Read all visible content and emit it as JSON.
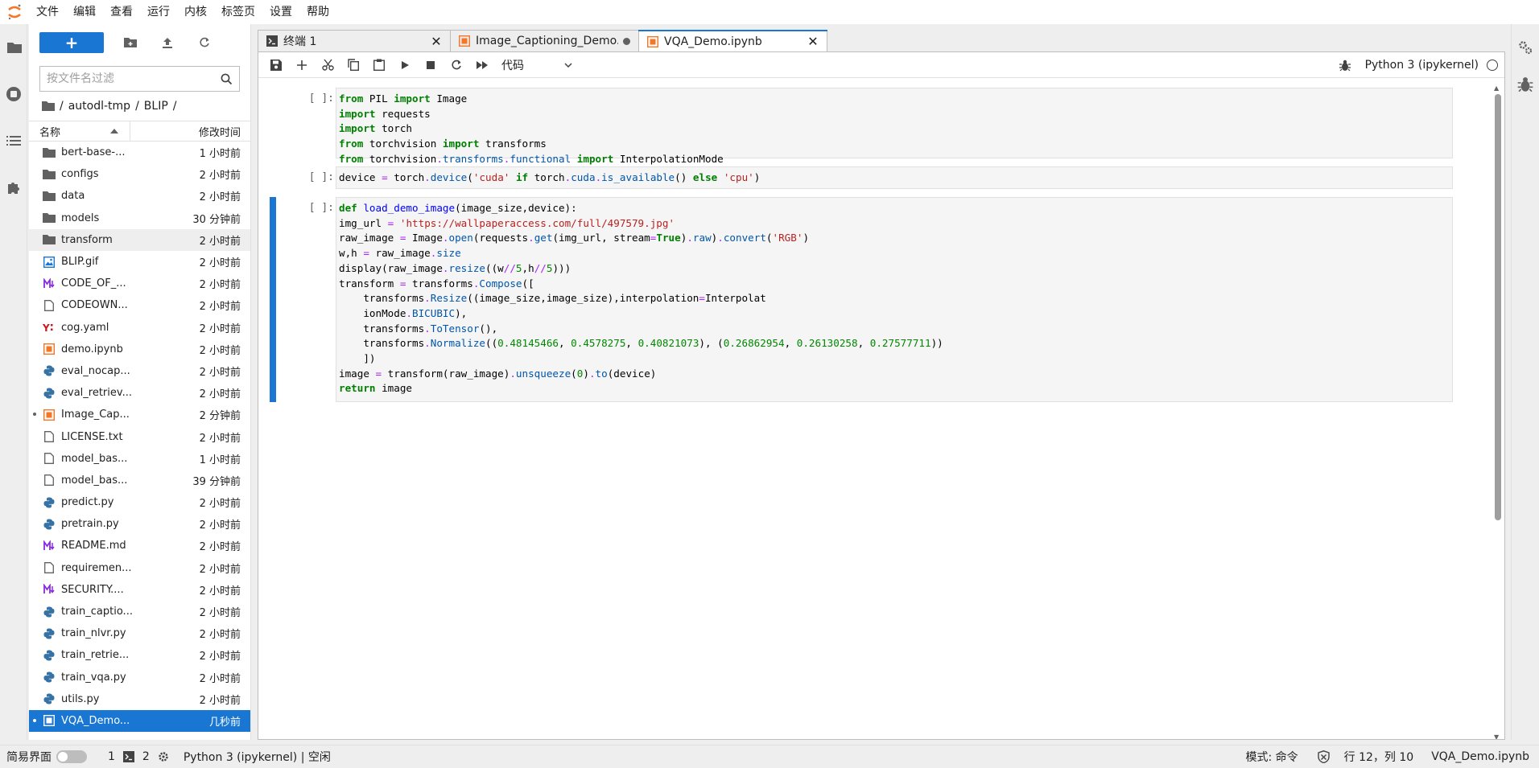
{
  "menubar": {
    "items": [
      "文件",
      "编辑",
      "查看",
      "运行",
      "内核",
      "标签页",
      "设置",
      "帮助"
    ]
  },
  "filebrowser": {
    "new_label": "+",
    "filter_placeholder": "按文件名过滤",
    "breadcrumb": [
      "/",
      "autodl-tmp",
      "/",
      "BLIP",
      "/"
    ],
    "col_name": "名称",
    "col_modified": "修改时间",
    "files": [
      {
        "name": "bert-base-...",
        "time": "1 小时前",
        "type": "folder"
      },
      {
        "name": "configs",
        "time": "2 小时前",
        "type": "folder"
      },
      {
        "name": "data",
        "time": "2 小时前",
        "type": "folder"
      },
      {
        "name": "models",
        "time": "30 分钟前",
        "type": "folder"
      },
      {
        "name": "transform",
        "time": "2 小时前",
        "type": "folder"
      },
      {
        "name": "BLIP.gif",
        "time": "2 小时前",
        "type": "image"
      },
      {
        "name": "CODE_OF_...",
        "time": "2 小时前",
        "type": "markdown"
      },
      {
        "name": "CODEOWN...",
        "time": "2 小时前",
        "type": "file"
      },
      {
        "name": "cog.yaml",
        "time": "2 小时前",
        "type": "yaml"
      },
      {
        "name": "demo.ipynb",
        "time": "2 小时前",
        "type": "notebook"
      },
      {
        "name": "eval_nocap...",
        "time": "2 小时前",
        "type": "python"
      },
      {
        "name": "eval_retriev...",
        "time": "2 小时前",
        "type": "python"
      },
      {
        "name": "Image_Cap...",
        "time": "2 分钟前",
        "type": "notebook"
      },
      {
        "name": "LICENSE.txt",
        "time": "2 小时前",
        "type": "file"
      },
      {
        "name": "model_bas...",
        "time": "1 小时前",
        "type": "file"
      },
      {
        "name": "model_bas...",
        "time": "39 分钟前",
        "type": "file"
      },
      {
        "name": "predict.py",
        "time": "2 小时前",
        "type": "python"
      },
      {
        "name": "pretrain.py",
        "time": "2 小时前",
        "type": "python"
      },
      {
        "name": "README.md",
        "time": "2 小时前",
        "type": "markdown"
      },
      {
        "name": "requiremen...",
        "time": "2 小时前",
        "type": "file"
      },
      {
        "name": "SECURITY....",
        "time": "2 小时前",
        "type": "markdown"
      },
      {
        "name": "train_captio...",
        "time": "2 小时前",
        "type": "python"
      },
      {
        "name": "train_nlvr.py",
        "time": "2 小时前",
        "type": "python"
      },
      {
        "name": "train_retrie...",
        "time": "2 小时前",
        "type": "python"
      },
      {
        "name": "train_vqa.py",
        "time": "2 小时前",
        "type": "python"
      },
      {
        "name": "utils.py",
        "time": "2 小时前",
        "type": "python"
      },
      {
        "name": "VQA_Demo...",
        "time": "几秒前",
        "type": "notebook"
      }
    ]
  },
  "tabs": [
    {
      "label": "终端 1",
      "icon": "terminal-icon"
    },
    {
      "label": "Image_Captioning_Demo.ipy",
      "icon": "notebook-icon"
    },
    {
      "label": "VQA_Demo.ipynb",
      "icon": "notebook-icon"
    }
  ],
  "toolbar": {
    "cell_type": "代码",
    "kernel_name": "Python 3 (ipykernel)"
  },
  "cells": [
    {
      "prompt": "[ ]:"
    },
    {
      "prompt": "[ ]:"
    },
    {
      "prompt": "[ ]:"
    }
  ],
  "statusbar": {
    "simple_mode": "简易界面",
    "terminals_count": "1",
    "kernels_count": "2",
    "kernel_status": "Python 3 (ipykernel) | 空闲",
    "mode": "模式: 命令",
    "cursor": "行 12，列 10",
    "filename": "VQA_Demo.ipynb"
  },
  "colors": {
    "accent": "#1976d2",
    "notebook_icon": "#f37726",
    "python_icon": "#3572a5",
    "markdown_icon": "#8a2be2",
    "yaml_icon": "#cb171e"
  }
}
